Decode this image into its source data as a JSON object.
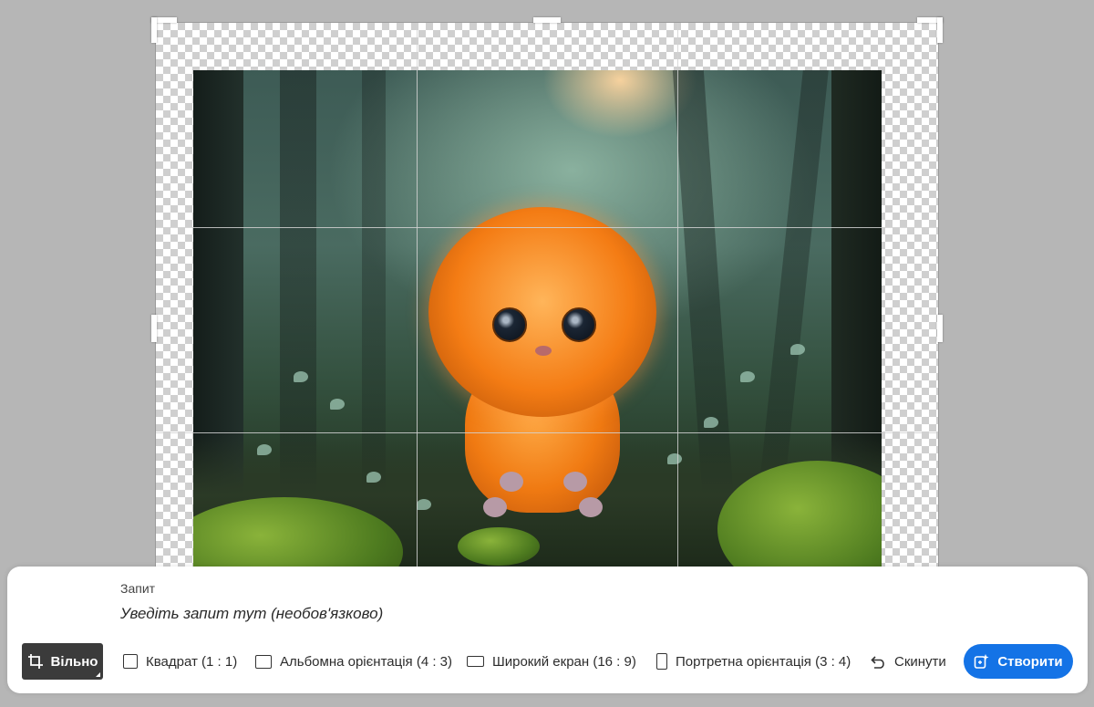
{
  "prompt": {
    "label": "Запит",
    "placeholder": "Уведіть запит тут (необов'язково)"
  },
  "toolbar": {
    "free": {
      "label": "Вільно",
      "icon": "crop-icon"
    },
    "square": {
      "label": "Квадрат (1 : 1)",
      "icon": "square-ratio-icon"
    },
    "landscape": {
      "label": "Альбомна орієнтація (4 : 3)",
      "icon": "landscape-ratio-icon"
    },
    "widescreen": {
      "label": "Широкий екран (16 : 9)",
      "icon": "widescreen-ratio-icon"
    },
    "portrait": {
      "label": "Портретна орієнтація (3 : 4)",
      "icon": "portrait-ratio-icon"
    },
    "reset": {
      "label": "Скинути",
      "icon": "undo-icon"
    },
    "create": {
      "label": "Створити",
      "icon": "generative-expand-icon"
    }
  },
  "colors": {
    "accent": "#1473e6",
    "active_tool_bg": "#3b3b3b",
    "workspace_bg": "#b6b6b6"
  }
}
